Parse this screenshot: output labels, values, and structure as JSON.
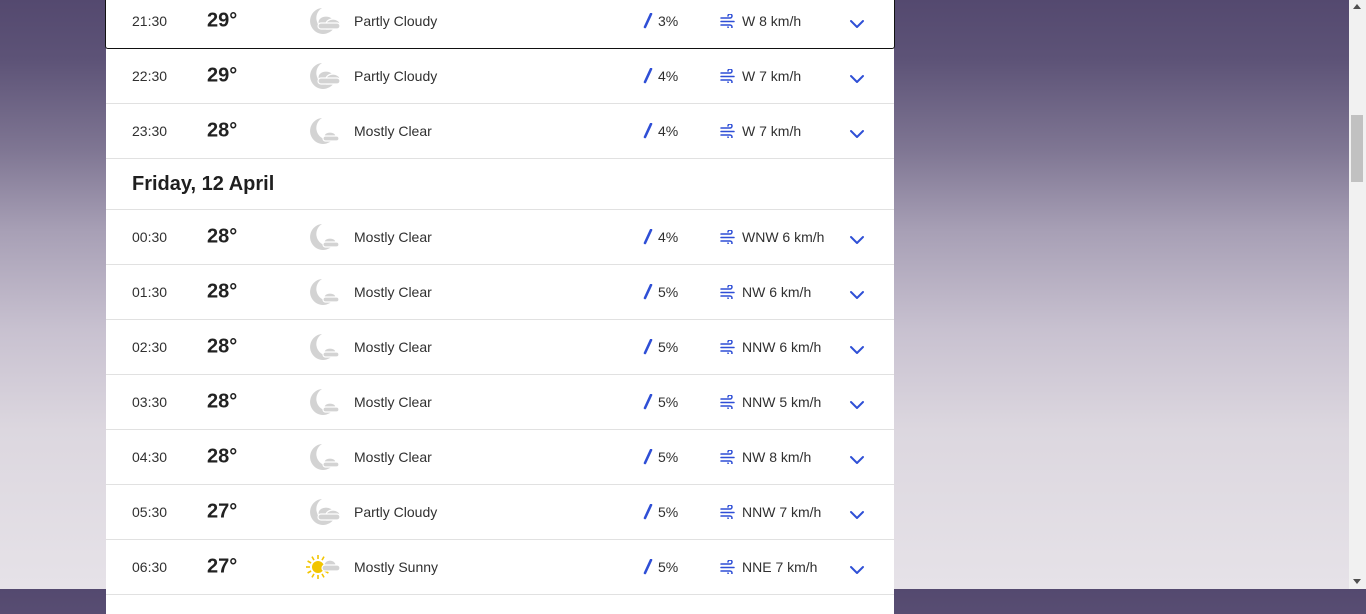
{
  "rows_before": [
    {
      "time": "21:30",
      "temp": "29°",
      "icon": "partly-cloudy-night-icon",
      "condition": "Partly Cloudy",
      "rain": "3%",
      "wind": "W 8 km/h",
      "selected": true
    },
    {
      "time": "22:30",
      "temp": "29°",
      "icon": "partly-cloudy-night-icon",
      "condition": "Partly Cloudy",
      "rain": "4%",
      "wind": "W 7 km/h"
    },
    {
      "time": "23:30",
      "temp": "28°",
      "icon": "mostly-clear-night-icon",
      "condition": "Mostly Clear",
      "rain": "4%",
      "wind": "W 7 km/h"
    }
  ],
  "day_header": "Friday, 12 April",
  "rows_after": [
    {
      "time": "00:30",
      "temp": "28°",
      "icon": "mostly-clear-night-icon",
      "condition": "Mostly Clear",
      "rain": "4%",
      "wind": "WNW 6 km/h"
    },
    {
      "time": "01:30",
      "temp": "28°",
      "icon": "mostly-clear-night-icon",
      "condition": "Mostly Clear",
      "rain": "5%",
      "wind": "NW 6 km/h"
    },
    {
      "time": "02:30",
      "temp": "28°",
      "icon": "mostly-clear-night-icon",
      "condition": "Mostly Clear",
      "rain": "5%",
      "wind": "NNW 6 km/h"
    },
    {
      "time": "03:30",
      "temp": "28°",
      "icon": "mostly-clear-night-icon",
      "condition": "Mostly Clear",
      "rain": "5%",
      "wind": "NNW 5 km/h"
    },
    {
      "time": "04:30",
      "temp": "28°",
      "icon": "mostly-clear-night-icon",
      "condition": "Mostly Clear",
      "rain": "5%",
      "wind": "NW 8 km/h"
    },
    {
      "time": "05:30",
      "temp": "27°",
      "icon": "partly-cloudy-night-icon",
      "condition": "Partly Cloudy",
      "rain": "5%",
      "wind": "NNW 7 km/h"
    },
    {
      "time": "06:30",
      "temp": "27°",
      "icon": "mostly-sunny-icon",
      "condition": "Mostly Sunny",
      "rain": "5%",
      "wind": "NNE 7 km/h"
    }
  ],
  "colors": {
    "accent": "#2f4fd6",
    "cloud": "#d3d3d3",
    "sun": "#f2c500"
  }
}
